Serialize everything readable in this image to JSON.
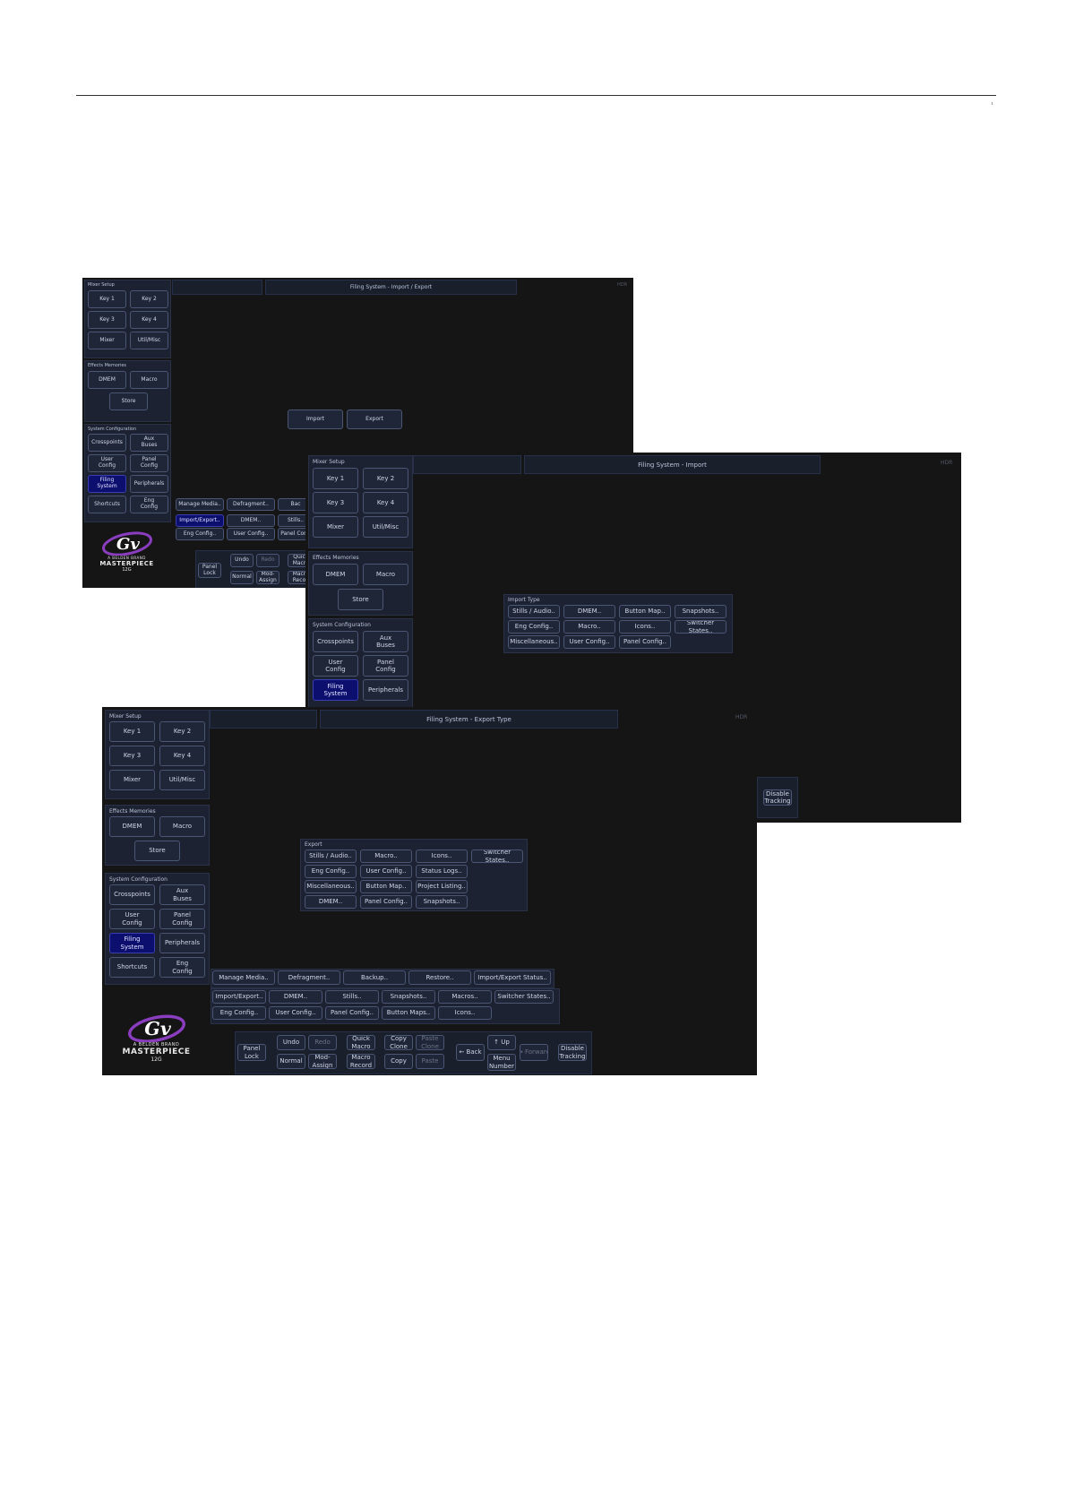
{
  "screen1": {
    "title": "Filing System - Import / Export",
    "corner": "HDR",
    "mixer_setup": {
      "title": "Mixer Setup",
      "buttons": [
        "Key 1",
        "Key 2",
        "Key 3",
        "Key 4",
        "Mixer",
        "Util/Misc"
      ]
    },
    "effects_memories": {
      "title": "Effects Memories",
      "dmem": "DMEM",
      "macro": "Macro",
      "store": "Store"
    },
    "system_config": {
      "title": "System Configuration",
      "buttons": [
        "Crosspoints",
        "Aux\nBuses",
        "User\nConfig",
        "Panel\nConfig",
        "Filing\nSystem",
        "Peripherals",
        "Shortcuts",
        "Eng\nConfig"
      ]
    },
    "main": {
      "import": "Import",
      "export": "Export"
    },
    "tabs_row1": [
      "Manage Media..",
      "Defragment..",
      "Bac"
    ],
    "tabs_row2": [
      "Import/Export..",
      "DMEM..",
      "Stills.."
    ],
    "tabs_row3": [
      "Eng Config..",
      "User Config..",
      "Panel Confi"
    ],
    "nav": {
      "panel_lock": "Panel\nLock",
      "undo": "Undo",
      "redo": "Redo",
      "normal": "Normal",
      "mod_assign": "Mod-\nAssign",
      "quick_macro": "Quic\nMacr",
      "macro_record": "Macr\nReco"
    },
    "logo": {
      "brand": "A BELDEN BRAND",
      "product": "MASTERPIECE",
      "model": "12G"
    }
  },
  "screen2": {
    "title": "Filing System - Import",
    "corner": "HDR",
    "mixer_setup": {
      "title": "Mixer Setup",
      "buttons": [
        "Key 1",
        "Key 2",
        "Key 3",
        "Key 4",
        "Mixer",
        "Util/Misc"
      ]
    },
    "effects_memories": {
      "title": "Effects Memories",
      "dmem": "DMEM",
      "macro": "Macro",
      "store": "Store"
    },
    "system_config": {
      "title": "System Configuration",
      "buttons": [
        "Crosspoints",
        "Aux\nBuses",
        "User\nConfig",
        "Panel\nConfig",
        "Filing\nSystem",
        "Peripherals"
      ]
    },
    "import_type": {
      "title": "Import Type",
      "buttons": [
        "Stills / Audio..",
        "DMEM..",
        "Button Map..",
        "Snapshots..",
        "Eng Config..",
        "Macro..",
        "Icons..",
        "Switcher States..",
        "Miscellaneous..",
        "User Config..",
        "Panel Config.."
      ]
    },
    "disable_tracking": "Disable\nTracking"
  },
  "screen3": {
    "title": "Filing System - Export Type",
    "corner": "HDR",
    "mixer_setup": {
      "title": "Mixer Setup",
      "buttons": [
        "Key 1",
        "Key 2",
        "Key 3",
        "Key 4",
        "Mixer",
        "Util/Misc"
      ]
    },
    "effects_memories": {
      "title": "Effects Memories",
      "dmem": "DMEM",
      "macro": "Macro",
      "store": "Store"
    },
    "system_config": {
      "title": "System Configuration",
      "buttons": [
        "Crosspoints",
        "Aux\nBuses",
        "User\nConfig",
        "Panel\nConfig",
        "Filing\nSystem",
        "Peripherals",
        "Shortcuts",
        "Eng\nConfig"
      ]
    },
    "export": {
      "title": "Export",
      "buttons": [
        "Stills / Audio..",
        "Macro..",
        "Icons..",
        "Switcher States..",
        "Eng Config..",
        "User Config..",
        "Status Logs..",
        "Miscellaneous..",
        "Button Map..",
        "Project Listing..",
        "DMEM..",
        "Panel Config..",
        "Snapshots.."
      ]
    },
    "tabs_row1": [
      "Manage Media..",
      "Defragment..",
      "Backup..",
      "Restore..",
      "Import/Export Status.."
    ],
    "tabs_row2": [
      "Import/Export..",
      "DMEM..",
      "Stills..",
      "Snapshots..",
      "Macros..",
      "Switcher States.."
    ],
    "tabs_row3": [
      "Eng Config..",
      "User Config..",
      "Panel Config..",
      "Button Maps..",
      "Icons.."
    ],
    "nav": {
      "panel_lock": "Panel\nLock",
      "undo": "Undo",
      "redo": "Redo",
      "normal": "Normal",
      "mod_assign": "Mod-\nAssign",
      "quick_macro": "Quick\nMacro",
      "macro_record": "Macro\nRecord",
      "copy_clone": "Copy\nClone",
      "copy": "Copy",
      "paste_clone": "Paste\nClone",
      "paste": "Paste",
      "back": "Back",
      "up": "Up",
      "menu_number": "Menu\nNumber",
      "forward": "Forward",
      "disable_tracking": "Disable\nTracking"
    },
    "logo": {
      "brand": "A BELDEN BRAND",
      "product": "MASTERPIECE",
      "model": "12G"
    }
  }
}
